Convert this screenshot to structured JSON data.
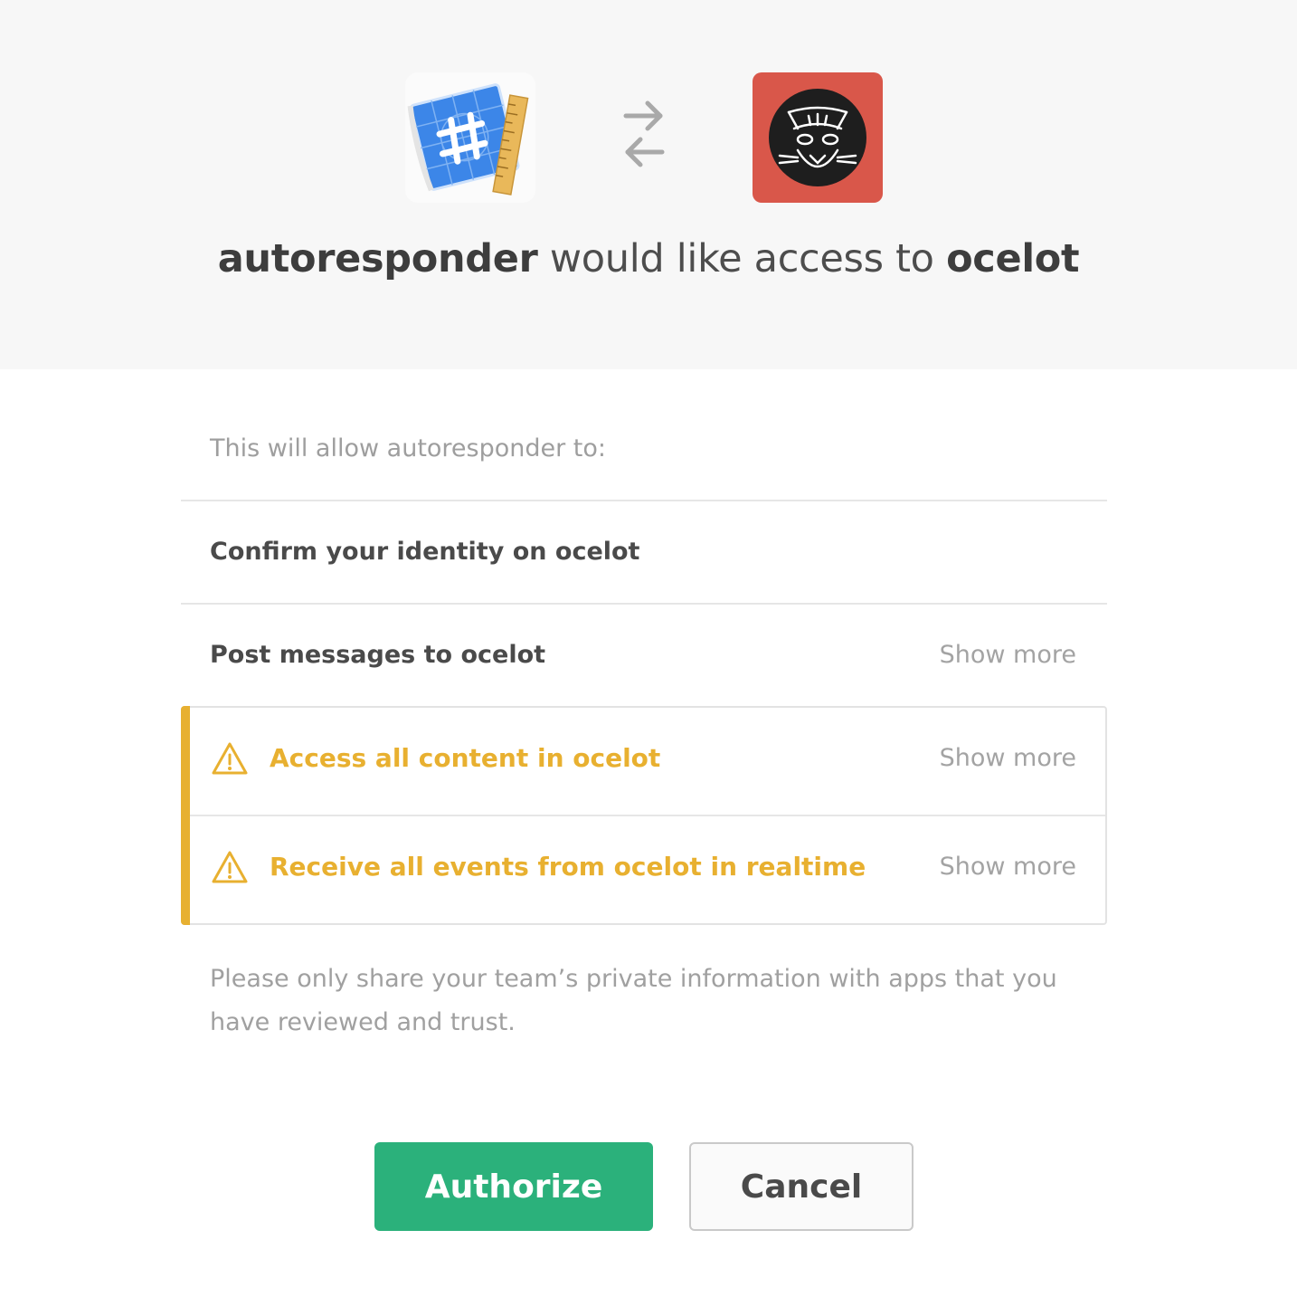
{
  "header": {
    "app_name": "autoresponder",
    "middle_text": " would like access to ",
    "team_name": "ocelot",
    "app_icon": "blueprint-hash-icon",
    "swap_icon": "swap-arrows-icon",
    "team_icon": "ocelot-avatar-icon"
  },
  "intro": "This will allow autoresponder to:",
  "permissions": [
    {
      "label": "Confirm your identity on ocelot"
    },
    {
      "label": "Post messages to ocelot",
      "action": "Show more"
    }
  ],
  "warnings": [
    {
      "label": "Access all content in ocelot",
      "action": "Show more",
      "icon": "warning-triangle-icon"
    },
    {
      "label": "Receive all events from ocelot in realtime",
      "action": "Show more",
      "icon": "warning-triangle-icon"
    }
  ],
  "note": "Please only share your team’s private information with apps that you have reviewed and trust.",
  "buttons": {
    "authorize": "Authorize",
    "cancel": "Cancel"
  },
  "colors": {
    "header_bg": "#f7f7f7",
    "warning": "#e8b030",
    "authorize": "#2bb17b",
    "team_icon_bg": "#d9574a"
  }
}
